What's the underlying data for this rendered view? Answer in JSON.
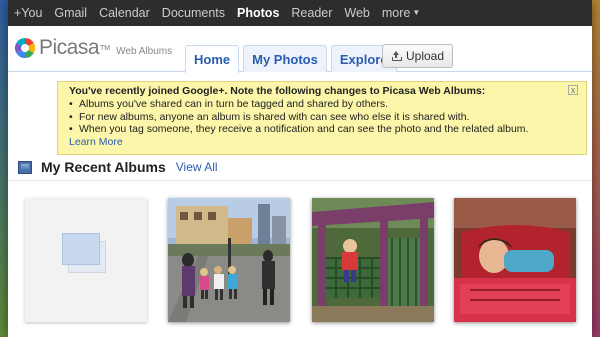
{
  "gbar": {
    "items": [
      "+You",
      "Gmail",
      "Calendar",
      "Documents",
      "Photos",
      "Reader",
      "Web",
      "more"
    ],
    "active": "Photos"
  },
  "logo": {
    "name": "Picasa",
    "tm": "TM",
    "sub": "Web Albums"
  },
  "tabs": [
    "Home",
    "My Photos",
    "Explore"
  ],
  "upload_label": "Upload",
  "notice": {
    "title": "You've recently joined Google+. Note the following changes to Picasa Web Albums:",
    "bullets": [
      "Albums you've shared can in turn be tagged and shared by others.",
      "For new albums, anyone an album is shared with can see who else it is shared with.",
      "When you tag someone, they receive a notification and can see the photo and the related album."
    ],
    "link": "Learn More",
    "close": "x"
  },
  "recent": {
    "title": "My Recent Albums",
    "view_all": "View All"
  },
  "colors": {
    "link": "#2a5db0",
    "notice_bg": "#fbf6a9",
    "gbar_bg": "#2d2d2d"
  }
}
